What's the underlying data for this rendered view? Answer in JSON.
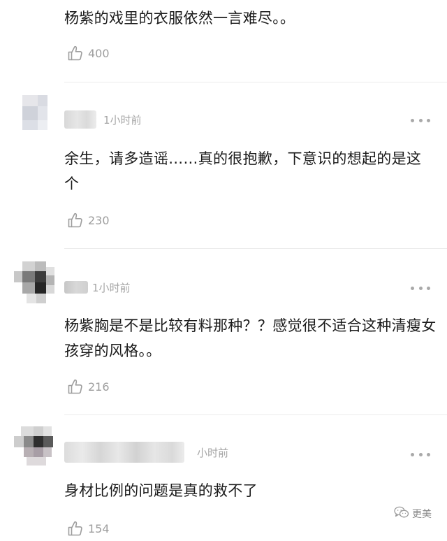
{
  "comments": [
    {
      "text": "杨紫的戏里的衣服依然一言难尽。。",
      "likes": "400"
    },
    {
      "time": "1小时前",
      "text": "余生，请多造谣……真的很抱歉，下意识的想起的是这个",
      "likes": "230"
    },
    {
      "time": "1小时前",
      "text": "杨紫胸是不是比较有料那种？？感觉很不适合这种清瘦女孩穿的风格。。",
      "likes": "216"
    },
    {
      "time": "小时前",
      "text": "身材比例的问题是真的救不了",
      "likes": "154"
    }
  ],
  "watermark": {
    "text": "更美",
    "icon": "wechat-icon"
  },
  "icons": {
    "like": "thumbs-up-icon",
    "more": "more-options-icon"
  }
}
